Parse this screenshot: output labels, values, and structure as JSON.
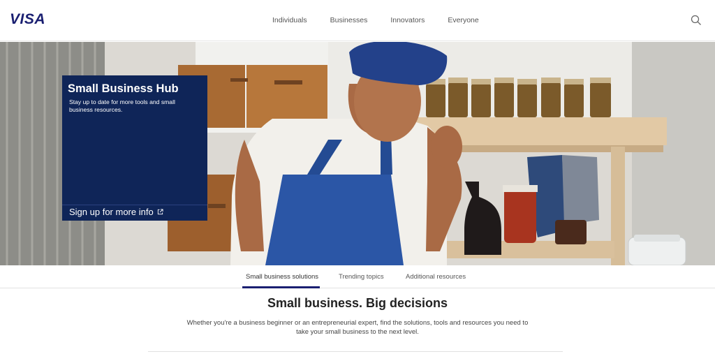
{
  "brand": {
    "logo_text": "VISA",
    "color": "#1a1f71"
  },
  "nav": {
    "items": [
      {
        "label": "Individuals"
      },
      {
        "label": "Businesses"
      },
      {
        "label": "Innovators"
      },
      {
        "label": "Everyone"
      }
    ],
    "search_icon": "search-icon"
  },
  "promo": {
    "title": "Small Business Hub",
    "subtitle": "Stay up to date for more tools and small business resources.",
    "link_label": "Sign up for more info",
    "link_icon": "external-link-icon",
    "background": "#0f2558"
  },
  "tabs": {
    "items": [
      {
        "label": "Small business solutions",
        "active": true
      },
      {
        "label": "Trending topics",
        "active": false
      },
      {
        "label": "Additional resources",
        "active": false
      }
    ]
  },
  "main": {
    "headline": "Small business. Big decisions",
    "intro": "Whether you're a business beginner or an entrepreneurial expert, find the solutions, tools and resources you need to take your small business to the next level."
  }
}
